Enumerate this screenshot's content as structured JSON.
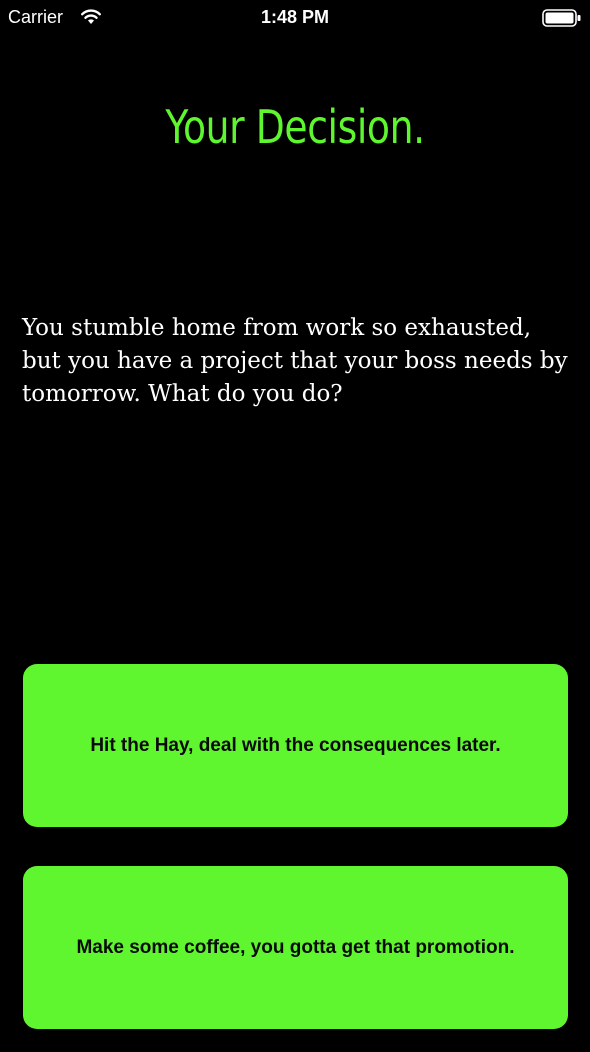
{
  "status_bar": {
    "carrier": "Carrier",
    "time": "1:48 PM",
    "wifi_icon": "wifi-icon",
    "battery_icon": "battery-icon"
  },
  "screen": {
    "title": "Your Decision.",
    "story_text": "You stumble home from work so exhausted, but you have a project that your boss needs by tomorrow. What do you do?"
  },
  "choices": [
    {
      "label": "Hit the Hay, deal with the consequences later."
    },
    {
      "label": "Make some coffee, you gotta get that promotion."
    }
  ],
  "colors": {
    "background": "#000000",
    "accent_green": "#5ff52f",
    "text": "#ffffff",
    "button_text": "#0a0a0a"
  }
}
